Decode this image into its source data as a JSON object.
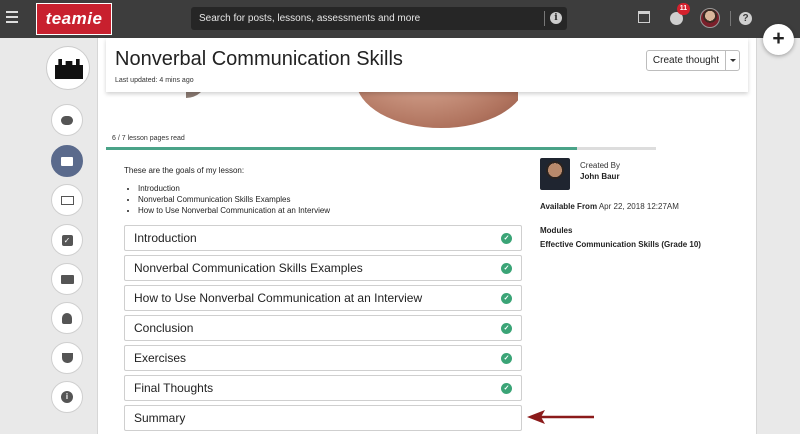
{
  "topbar": {
    "logo_text": "teamie",
    "search_placeholder": "Search for posts, lessons, assessments and more",
    "notifications_count": "11"
  },
  "page": {
    "title": "Nonverbal Communication Skills",
    "last_updated": "Last updated: 4 mins ago",
    "create_thought_label": "Create thought"
  },
  "progress": {
    "label": "6 / 7 lesson pages read",
    "read": 6,
    "total": 7
  },
  "goals": {
    "intro": "These are the goals of my lesson:",
    "items": [
      "Introduction",
      "Nonverbal Communication Skills Examples",
      "How to Use Nonverbal Communication at an Interview"
    ]
  },
  "sections": [
    {
      "title": "Introduction",
      "completed": true
    },
    {
      "title": "Nonverbal Communication Skills Examples",
      "completed": true
    },
    {
      "title": "How to Use Nonverbal Communication at an Interview",
      "completed": true
    },
    {
      "title": "Conclusion",
      "completed": true
    },
    {
      "title": "Exercises",
      "completed": true
    },
    {
      "title": "Final Thoughts",
      "completed": true
    },
    {
      "title": "Summary",
      "completed": false
    }
  ],
  "sidebar_info": {
    "created_by_label": "Created By",
    "author": "John Baur",
    "available_from_label": "Available From",
    "available_from_value": "Apr 22, 2018 12:27AM",
    "modules_label": "Modules",
    "module_name": "Effective Communication Skills (Grade 10)"
  },
  "colors": {
    "brand": "#c8202e",
    "progress": "#4aa388",
    "check": "#3aa476",
    "arrow": "#8b1a1a",
    "rail_active": "#5a6a8c"
  },
  "rail_icons": [
    "chat-bubble-icon",
    "folder-icon",
    "id-card-icon",
    "checkbox-icon",
    "monitor-icon",
    "user-icon",
    "trophy-icon",
    "info-icon"
  ]
}
